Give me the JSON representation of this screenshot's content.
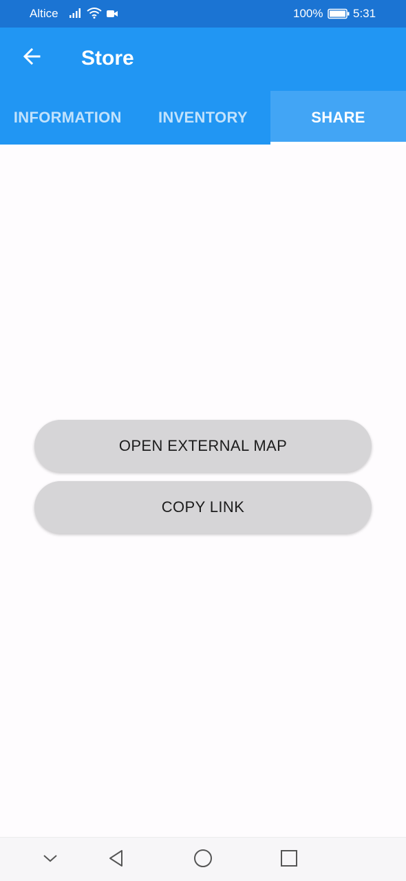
{
  "status_bar": {
    "carrier": "Altice",
    "battery_percent": "100%",
    "time": "5:31",
    "icons": [
      "signal-icon",
      "wifi-icon",
      "video-call-icon",
      "battery-icon"
    ]
  },
  "app_bar": {
    "title": "Store",
    "back_icon": "arrow-back-icon"
  },
  "tabs": [
    {
      "label": "INFORMATION",
      "active": false
    },
    {
      "label": "INVENTORY",
      "active": false
    },
    {
      "label": "SHARE",
      "active": true
    }
  ],
  "actions": {
    "open_map_label": "OPEN EXTERNAL MAP",
    "copy_link_label": "COPY LINK"
  },
  "nav_bar": {
    "icons": [
      "chevron-down-icon",
      "back-triangle-icon",
      "home-circle-icon",
      "recents-square-icon"
    ]
  },
  "colors": {
    "status_bar": "#1b74d3",
    "primary": "#2196f3",
    "active_tab": "#42a5f5",
    "button": "#d6d5d7"
  }
}
